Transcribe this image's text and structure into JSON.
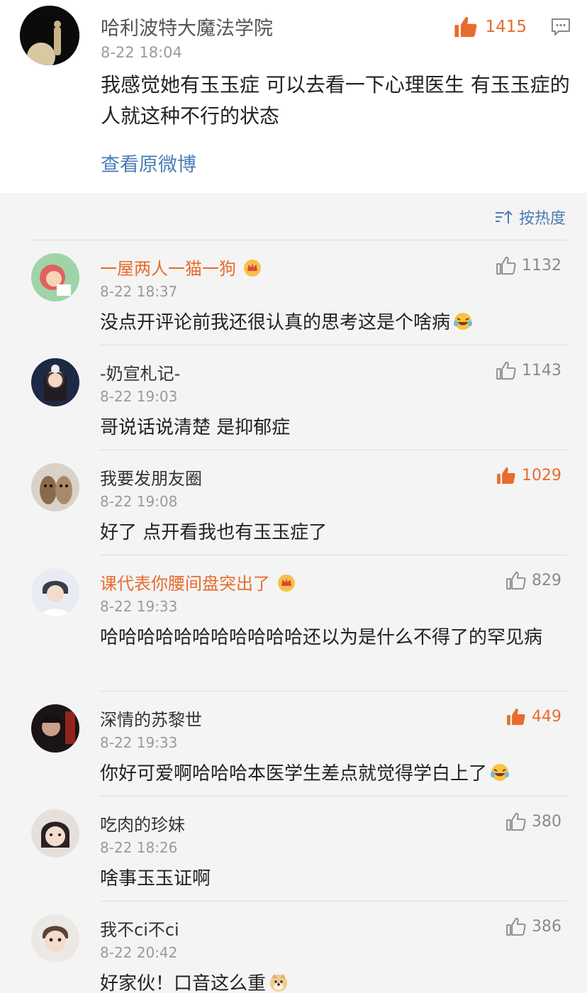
{
  "post": {
    "author": "哈利波特大魔法学院",
    "time": "8-22 18:04",
    "text": "我感觉她有玉玉症 可以去看一下心理医生 有玉玉症的人就这种不行的状态",
    "likes": "1415",
    "view_original": "查看原微博"
  },
  "sort": {
    "label": "按热度",
    "icon": "sort-icon"
  },
  "comments": [
    {
      "name": "一屋两人一猫一狗",
      "vip": true,
      "time": "8-22 18:37",
      "text": "没点开评论前我还很认真的思考这是个啥病",
      "emoji": "laugh-cry",
      "likes": "1132",
      "liked": false
    },
    {
      "name": "-奶宣札记-",
      "vip": false,
      "time": "8-22 19:03",
      "text": "哥说话说清楚 是抑郁症",
      "emoji": "",
      "likes": "1143",
      "liked": false
    },
    {
      "name": "我要发朋友圈",
      "vip": false,
      "time": "8-22 19:08",
      "text": "好了 点开看我也有玉玉症了",
      "emoji": "",
      "likes": "1029",
      "liked": true
    },
    {
      "name": "课代表你腰间盘突出了",
      "vip": true,
      "time": "8-22 19:33",
      "text": "哈哈哈哈哈哈哈哈哈哈哈还以为是什么不得了的罕见病",
      "emoji": "",
      "likes": "829",
      "liked": false
    },
    {
      "name": "深情的苏黎世",
      "vip": false,
      "time": "8-22 19:33",
      "text": "你好可爱啊哈哈哈本医学生差点就觉得学白上了",
      "emoji": "laugh-cry",
      "likes": "449",
      "liked": true
    },
    {
      "name": "吃肉的珍妹",
      "vip": false,
      "time": "8-22 18:26",
      "text": "啥事玉玉证啊",
      "emoji": "",
      "likes": "380",
      "liked": false
    },
    {
      "name": "我不ci不ci",
      "vip": false,
      "time": "8-22 20:42",
      "text": "好家伙！口音这么重",
      "emoji": "doge",
      "likes": "386",
      "liked": false
    }
  ],
  "colors": {
    "accent": "#e86b2e",
    "link": "#4a7db5",
    "muted": "#9a9a9a"
  }
}
